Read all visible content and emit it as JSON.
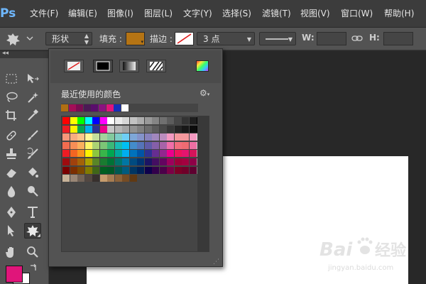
{
  "app": {
    "logo": "Ps"
  },
  "menu": [
    {
      "label": "文件(F)"
    },
    {
      "label": "编辑(E)"
    },
    {
      "label": "图像(I)"
    },
    {
      "label": "图层(L)"
    },
    {
      "label": "文字(Y)"
    },
    {
      "label": "选择(S)"
    },
    {
      "label": "滤镜(T)"
    },
    {
      "label": "视图(V)"
    },
    {
      "label": "窗口(W)"
    },
    {
      "label": "帮助(H)"
    }
  ],
  "options": {
    "mode": "形状",
    "fill_label": "填充 :",
    "fill_color": "#b57414",
    "stroke_label": "描边 :",
    "stroke_size": "3 点",
    "w_label": "W:",
    "h_label": "H:"
  },
  "popup": {
    "recent_label": "最近使用的颜色",
    "recent_colors": [
      "#b06f12",
      "#a30e57",
      "#7b0d52",
      "#4b1a55",
      "#5a0d6c",
      "#8b1280",
      "#e0157a",
      "#1730b8",
      "#ffffff"
    ],
    "swatch_rows": [
      [
        "#ff0000",
        "#ffff00",
        "#00ff00",
        "#00ffff",
        "#0000ff",
        "#ff00ff",
        "#ffffff",
        "#eaeaea",
        "#d6d6d6",
        "#c2c2c2",
        "#adadad",
        "#999999",
        "#858585",
        "#707070",
        "#5c5c5c",
        "#474747",
        "#333333",
        "#1f1f1f",
        "#000000"
      ],
      [
        "#ee1c24",
        "#fff200",
        "#00a651",
        "#00aeef",
        "#2e3192",
        "#ec008c",
        "#c7c7c7",
        "#b5b5b5",
        "#a3a3a3",
        "#919191",
        "#7f7f7f",
        "#6d6d6d",
        "#5b5b5b",
        "#494949",
        "#373737",
        "#252525",
        "#181818",
        "#0c0c0c",
        "#000000"
      ],
      [
        "#f7977a",
        "#f9ad81",
        "#fdc68a",
        "#fff79a",
        "#c4df9b",
        "#a3d39c",
        "#82ca9d",
        "#7bcdc8",
        "#6ecff6",
        "#7ea7d8",
        "#8493ca",
        "#8882be",
        "#a187be",
        "#bc8dbf",
        "#f49ac2",
        "#f6989d",
        "#f5989d",
        "#f49ac1",
        "#e6e6e6"
      ],
      [
        "#f26c4f",
        "#f68e56",
        "#fbaf5d",
        "#fff568",
        "#acd373",
        "#7cc576",
        "#3bb878",
        "#1abbb4",
        "#00bff3",
        "#438ccb",
        "#5574b9",
        "#605ca8",
        "#855fa8",
        "#a763a8",
        "#f06ea9",
        "#f26d7d",
        "#ef6b72",
        "#ee6fa3",
        "#cfcfcf"
      ],
      [
        "#ed1c24",
        "#f26522",
        "#f7941d",
        "#fff200",
        "#8dc63f",
        "#39b54a",
        "#00a651",
        "#00a99d",
        "#00aeef",
        "#0072bc",
        "#0054a6",
        "#2e3192",
        "#662d91",
        "#92278f",
        "#ec008c",
        "#ed145b",
        "#e5146e",
        "#d4145a",
        "#b8b8b8"
      ],
      [
        "#9e0b0f",
        "#a0410d",
        "#a36209",
        "#aba000",
        "#598527",
        "#1a7b30",
        "#007236",
        "#00746b",
        "#0076a3",
        "#004b80",
        "#003471",
        "#1b1464",
        "#440e62",
        "#630460",
        "#9e005d",
        "#9e0039",
        "#a3003f",
        "#8e0047",
        "#a0a0a0"
      ],
      [
        "#790000",
        "#7b2e00",
        "#7d4900",
        "#827b00",
        "#406618",
        "#005e20",
        "#005826",
        "#005952",
        "#005b7f",
        "#003663",
        "#002157",
        "#0d004c",
        "#32004b",
        "#4b0049",
        "#7b0046",
        "#7a0026",
        "#6f0029",
        "#5e0030",
        "#898989"
      ],
      [
        "#c7b299",
        "#998675",
        "#736357",
        "#534741",
        "#37302d",
        "#c69c6d",
        "#a67c52",
        "#8c6239",
        "#754c24",
        "#603913"
      ]
    ]
  }
}
